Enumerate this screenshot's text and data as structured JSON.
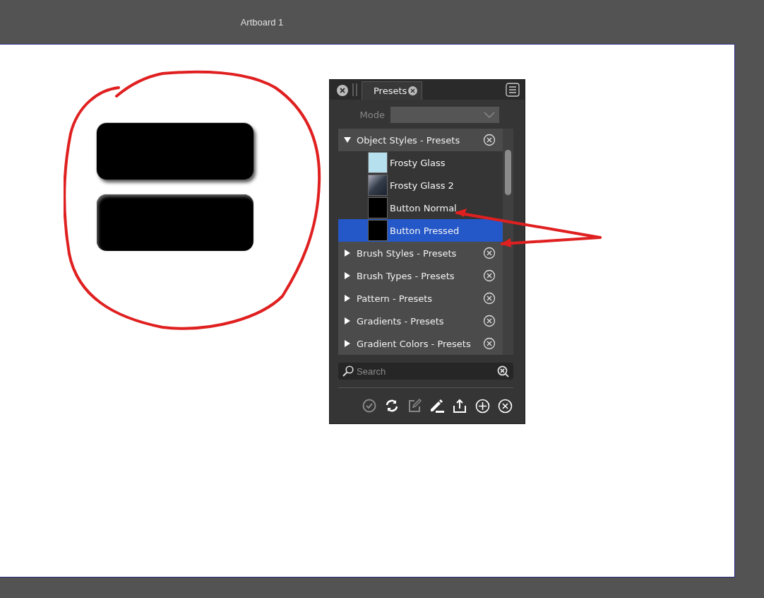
{
  "artboard": {
    "title": "Artboard 1"
  },
  "panel": {
    "tabs": [
      {
        "label": "Presets",
        "selected": true
      }
    ],
    "mode": {
      "label": "Mode",
      "disabled": true
    },
    "groups": [
      {
        "label": "Object Styles - Presets",
        "expanded": true,
        "items": [
          {
            "label": "Frosty Glass",
            "kind": "frost",
            "selected": false
          },
          {
            "label": "Frosty Glass 2",
            "kind": "gradient",
            "selected": false
          },
          {
            "label": "Button Normal",
            "kind": "solid",
            "selected": false
          },
          {
            "label": "Button Pressed",
            "kind": "solid",
            "selected": true
          }
        ]
      },
      {
        "label": "Brush Styles - Presets",
        "expanded": false
      },
      {
        "label": "Brush Types - Presets",
        "expanded": false
      },
      {
        "label": "Pattern - Presets",
        "expanded": false
      },
      {
        "label": "Gradients - Presets",
        "expanded": false
      },
      {
        "label": "Gradient Colors - Presets",
        "expanded": false
      }
    ],
    "search": {
      "placeholder": "Search"
    },
    "tools": [
      {
        "kind": "check",
        "disabled": true
      },
      {
        "kind": "refresh",
        "disabled": false
      },
      {
        "kind": "edit",
        "disabled": true
      },
      {
        "kind": "pencil",
        "disabled": false
      },
      {
        "kind": "share",
        "disabled": false
      },
      {
        "kind": "add",
        "disabled": false
      },
      {
        "kind": "remove",
        "disabled": false
      }
    ]
  }
}
